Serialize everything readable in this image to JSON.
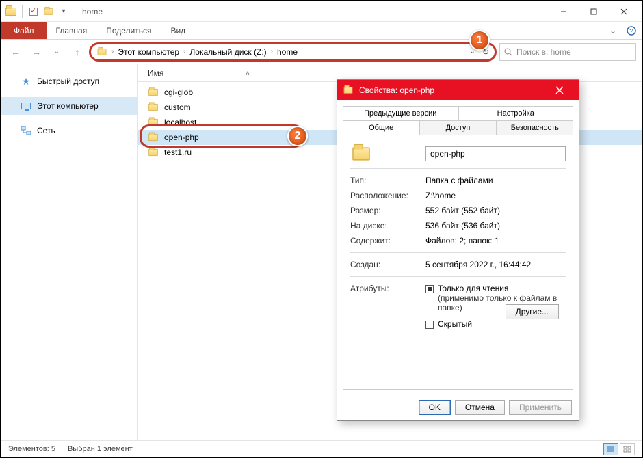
{
  "window": {
    "title": "home"
  },
  "ribbon": {
    "file": "Файл",
    "home": "Главная",
    "share": "Поделиться",
    "view": "Вид"
  },
  "nav": {
    "crumbs": [
      "Этот компьютер",
      "Локальный диск (Z:)",
      "home"
    ],
    "search_placeholder": "Поиск в: home"
  },
  "sidebar": {
    "items": [
      {
        "label": "Быстрый доступ"
      },
      {
        "label": "Этот компьютер"
      },
      {
        "label": "Сеть"
      }
    ]
  },
  "columns": {
    "name": "Имя"
  },
  "files": [
    {
      "name": "cgi-glob"
    },
    {
      "name": "custom"
    },
    {
      "name": "localhost"
    },
    {
      "name": "open-php"
    },
    {
      "name": "test1.ru"
    }
  ],
  "status": {
    "count": "Элементов: 5",
    "selected": "Выбран 1 элемент"
  },
  "dialog": {
    "title": "Свойства: open-php",
    "tabs_row1": [
      "Предыдущие версии",
      "Настройка"
    ],
    "tabs_row2": [
      "Общие",
      "Доступ",
      "Безопасность"
    ],
    "name_value": "open-php",
    "type_k": "Тип:",
    "type_v": "Папка с файлами",
    "loc_k": "Расположение:",
    "loc_v": "Z:\\home",
    "size_k": "Размер:",
    "size_v": "552 байт (552 байт)",
    "disk_k": "На диске:",
    "disk_v": "536 байт (536 байт)",
    "cont_k": "Содержит:",
    "cont_v": "Файлов: 2; папок: 1",
    "created_k": "Создан:",
    "created_v": "5 сентября 2022 г., 16:44:42",
    "attr_k": "Атрибуты:",
    "readonly": "Только для чтения",
    "readonly_hint": "(применимо только к файлам в папке)",
    "hidden": "Скрытый",
    "other": "Другие...",
    "ok": "OK",
    "cancel": "Отмена",
    "apply": "Применить"
  },
  "badges": {
    "b1": "1",
    "b2": "2"
  }
}
